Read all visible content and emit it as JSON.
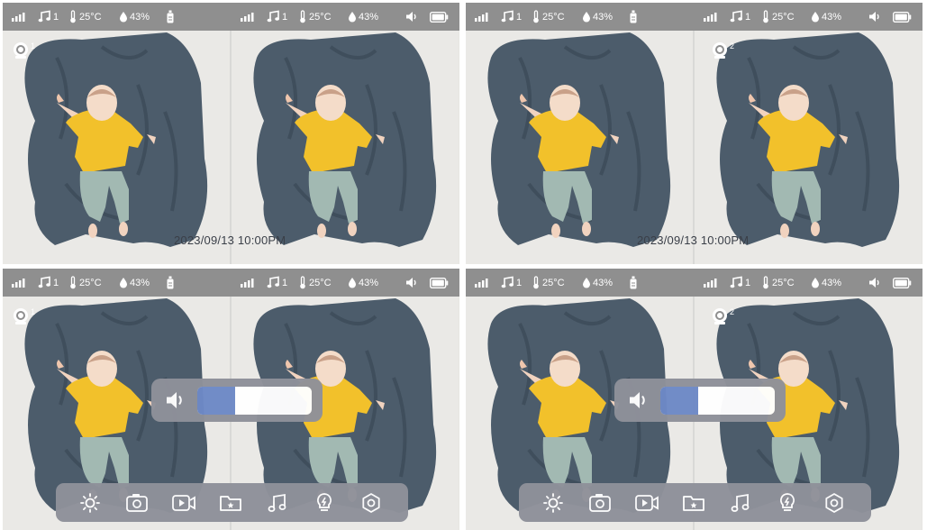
{
  "status": {
    "music_channel": "1",
    "temperature": "25°C",
    "humidity": "43%"
  },
  "screens": [
    {
      "camera_number": "1",
      "timestamp": "2023/09/13 10:00PM"
    },
    {
      "camera_number": "2",
      "timestamp": "2023/09/13 10:00PM"
    },
    {
      "camera_number": "1"
    },
    {
      "camera_number": "2"
    }
  ],
  "volume": {
    "level_percent": 33
  },
  "toolbar": {
    "icons": [
      "brightness-icon",
      "camera-icon",
      "video-record-icon",
      "folder-icon",
      "music-icon",
      "light-icon",
      "settings-icon"
    ]
  },
  "colors": {
    "status_bar": "#8f8f8f",
    "overlay_panel": "#8f919a",
    "volume_fill": "#6e89c6",
    "blanket": "#4c5c6b",
    "sweater": "#f2c12b"
  }
}
